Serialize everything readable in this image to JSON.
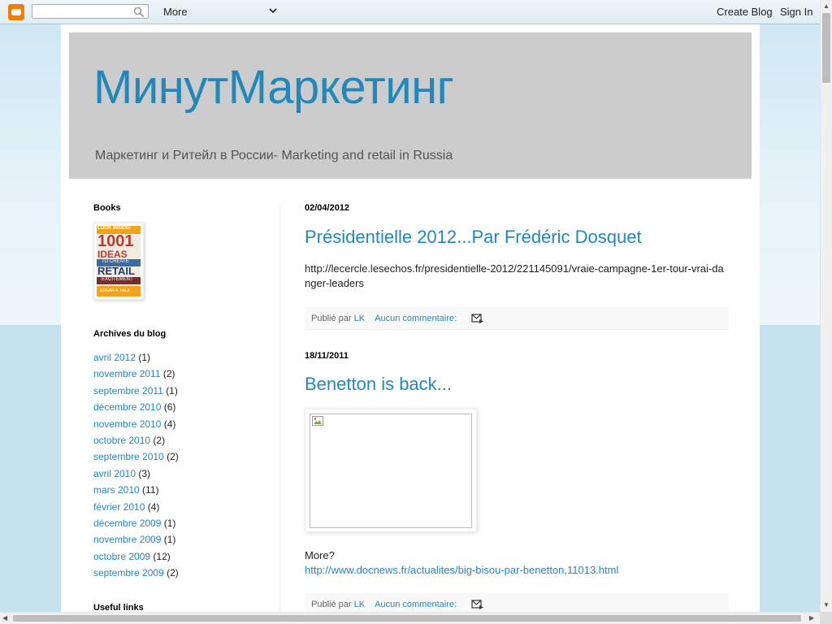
{
  "navbar": {
    "more_label": "More",
    "create_blog": "Create Blog",
    "sign_in": "Sign In"
  },
  "header": {
    "title": "МинутМаркетинг",
    "description": "Маркетинг и Ритейл в России- Marketing and retail in Russia"
  },
  "sidebar": {
    "books_title": "Books",
    "book_cover_text": {
      "look_inside": "LOOK INSIDE!",
      "number": "1001",
      "ideas": "IDEAS",
      "to_create": "TO CREATE",
      "retail": "RETAIL",
      "excitement": "EXCITEMENT",
      "author": "EDGAR A. FALK"
    },
    "archives_title": "Archives du blog",
    "archives": [
      {
        "label": "avril 2012",
        "count": "(1)"
      },
      {
        "label": "novembre 2011",
        "count": "(2)"
      },
      {
        "label": "septembre 2011",
        "count": "(1)"
      },
      {
        "label": "décembre 2010",
        "count": "(6)"
      },
      {
        "label": "novembre 2010",
        "count": "(4)"
      },
      {
        "label": "octobre 2010",
        "count": "(2)"
      },
      {
        "label": "septembre 2010",
        "count": "(2)"
      },
      {
        "label": "avril 2010",
        "count": "(3)"
      },
      {
        "label": "mars 2010",
        "count": "(11)"
      },
      {
        "label": "février 2010",
        "count": "(4)"
      },
      {
        "label": "décembre 2009",
        "count": "(1)"
      },
      {
        "label": "novembre 2009",
        "count": "(1)"
      },
      {
        "label": "octobre 2009",
        "count": "(12)"
      },
      {
        "label": "septembre 2009",
        "count": "(2)"
      }
    ],
    "useful_links_title": "Useful links"
  },
  "posts": [
    {
      "date": "02/04/2012",
      "title": "Présidentielle 2012...Par Frédéric Dosquet",
      "body": "http://lecercle.lesechos.fr/presidentielle-2012/221145091/vraie-campagne-1er-tour-vrai-danger-leaders",
      "published_by": "Publié par",
      "author": "LK",
      "comments": "Aucun commentaire:"
    },
    {
      "date": "18/11/2011",
      "title": "Benetton is back...",
      "more": "More?",
      "link": "http://www.docnews.fr/actualites/big-bisou-par-benetton,11013.html",
      "published_by": "Publié par",
      "author": "LK",
      "comments": "Aucun commentaire:"
    }
  ],
  "colors": {
    "accent": "#2288bb",
    "header_bg": "#cccccc",
    "body_bg": "#c6e2ef",
    "blogger_orange": "#f57d00"
  }
}
